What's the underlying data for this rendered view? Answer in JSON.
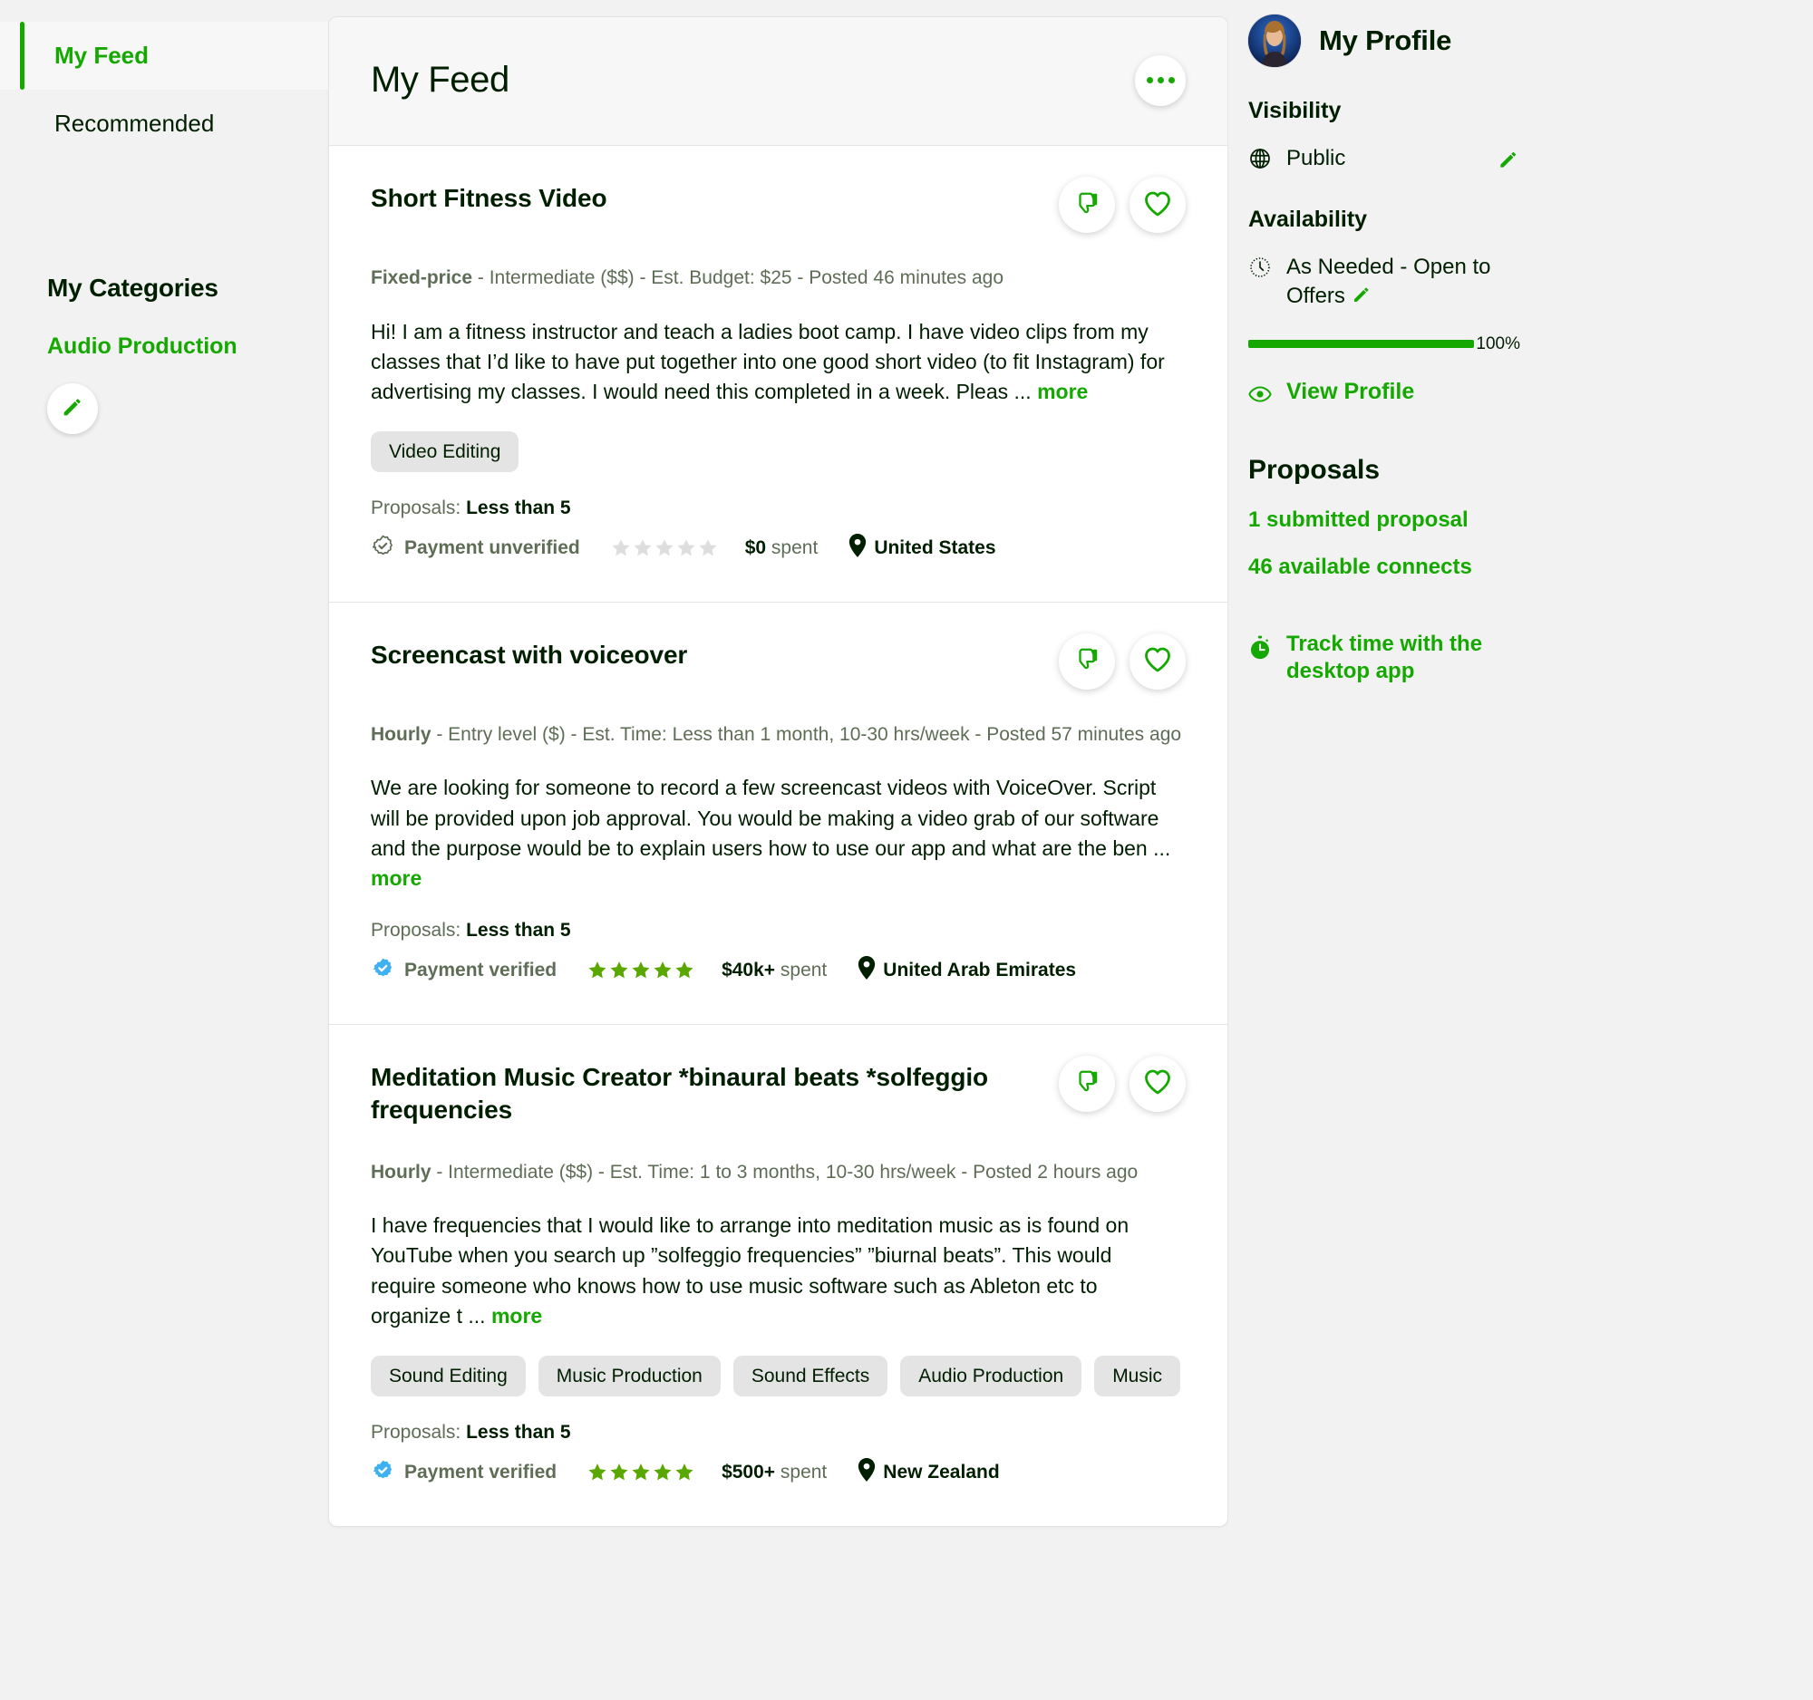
{
  "sidebar": {
    "nav": [
      {
        "label": "My Feed",
        "active": true
      },
      {
        "label": "Recommended",
        "active": false
      }
    ],
    "categories_heading": "My Categories",
    "category": "Audio Production",
    "edit_icon": "pencil-icon"
  },
  "feed": {
    "title": "My Feed",
    "menu_icon": "ellipsis-icon",
    "jobs": [
      {
        "title": "Short Fitness Video",
        "type": "Fixed-price",
        "meta_rest": " - Intermediate ($$) - Est. Budget: $25 - Posted 46 minutes ago",
        "description": "Hi! I am a fitness instructor and teach a ladies boot camp. I have video clips from my classes that I’d like to have put together into one good short video (to fit Instagram) for advertising my classes. I would need this completed in a week. Pleas ... ",
        "more_label": "more",
        "tags": [
          "Video Editing"
        ],
        "proposals_label": "Proposals: ",
        "proposals_value": "Less than 5",
        "payment_status": "Payment unverified",
        "payment_verified": false,
        "rating": 0,
        "spent_amount": "$0",
        "spent_suffix": " spent",
        "location": "United States",
        "dislike_icon": "thumbs-down-icon",
        "like_icon": "heart-icon"
      },
      {
        "title": "Screencast with voiceover",
        "type": "Hourly",
        "meta_rest": " - Entry level ($) - Est. Time: Less than 1 month, 10-30 hrs/week - Posted 57 minutes ago",
        "description": "We are looking for someone to record a few screencast videos with VoiceOver. Script will be provided upon job approval. You would be making a video grab of our software and the purpose would be to explain users how to use our app and what are the ben ... ",
        "more_label": "more",
        "tags": [],
        "proposals_label": "Proposals: ",
        "proposals_value": "Less than 5",
        "payment_status": "Payment verified",
        "payment_verified": true,
        "rating": 5,
        "spent_amount": "$40k+",
        "spent_suffix": " spent",
        "location": "United Arab Emirates",
        "dislike_icon": "thumbs-down-icon",
        "like_icon": "heart-icon"
      },
      {
        "title": "Meditation Music Creator *binaural beats *solfeggio frequencies",
        "type": "Hourly",
        "meta_rest": " - Intermediate ($$) - Est. Time: 1 to 3 months, 10-30 hrs/week - Posted 2 hours ago",
        "description": "I have frequencies that I would like to arrange into meditation music as is found on YouTube when you search up ”solfeggio frequencies” ”biurnal beats”. This would require someone who knows how to use music software such as Ableton etc to organize t ... ",
        "more_label": "more",
        "tags": [
          "Sound Editing",
          "Music Production",
          "Sound Effects",
          "Audio Production",
          "Music"
        ],
        "proposals_label": "Proposals: ",
        "proposals_value": "Less than 5",
        "payment_status": "Payment verified",
        "payment_verified": true,
        "rating": 5,
        "spent_amount": "$500+",
        "spent_suffix": " spent",
        "location": "New Zealand",
        "dislike_icon": "thumbs-down-icon",
        "like_icon": "heart-icon"
      }
    ]
  },
  "profile": {
    "name": "My Profile",
    "avatar_icon": "user-avatar",
    "visibility_heading": "Visibility",
    "visibility_value": "Public",
    "visibility_icon": "globe-icon",
    "visibility_edit_icon": "pencil-icon",
    "availability_heading": "Availability",
    "availability_value": "As Needed - Open to Offers",
    "availability_icon": "clock-icon",
    "availability_edit_icon": "pencil-icon",
    "completeness_percent": "100%",
    "completeness_value": 100,
    "view_profile_label": "View Profile",
    "view_profile_icon": "eye-icon",
    "proposals_heading": "Proposals",
    "submitted_proposals": "1 submitted proposal",
    "available_connects": "46 available connects",
    "track_time_label": "Track time with the desktop app",
    "track_time_icon": "stopwatch-icon"
  },
  "colors": {
    "accent_green": "#14a800",
    "verified_blue": "#3db1f2",
    "star_green": "#5aa700",
    "text_dark": "#001e00",
    "text_muted": "#5e6d55",
    "tag_bg": "#e4e4e4"
  }
}
